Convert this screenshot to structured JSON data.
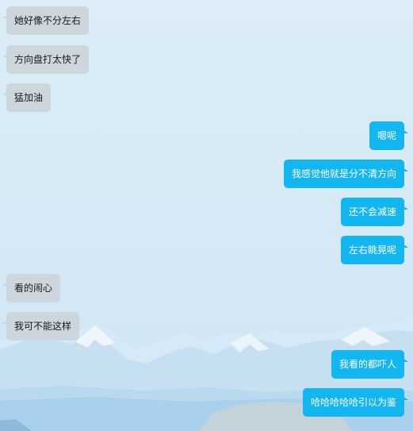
{
  "colors": {
    "left_bubble": "#cdd6dd",
    "right_bubble": "#13b6ef",
    "background": "#dcedf7"
  },
  "messages": [
    {
      "side": "left",
      "text": "她好像不分左右"
    },
    {
      "side": "left",
      "text": "方向盘打太快了"
    },
    {
      "side": "left",
      "text": "猛加油"
    },
    {
      "side": "right",
      "text": "嗯呢"
    },
    {
      "side": "right",
      "text": "我感觉他就是分不清方向"
    },
    {
      "side": "right",
      "text": "还不会减速"
    },
    {
      "side": "right",
      "text": "左右眺晃呢"
    },
    {
      "side": "left",
      "text": "看的闹心"
    },
    {
      "side": "left",
      "text": "我可不能这样"
    },
    {
      "side": "right",
      "text": "我看的都吓人"
    },
    {
      "side": "right",
      "text": "哈哈哈哈哈引以为鉴"
    }
  ]
}
